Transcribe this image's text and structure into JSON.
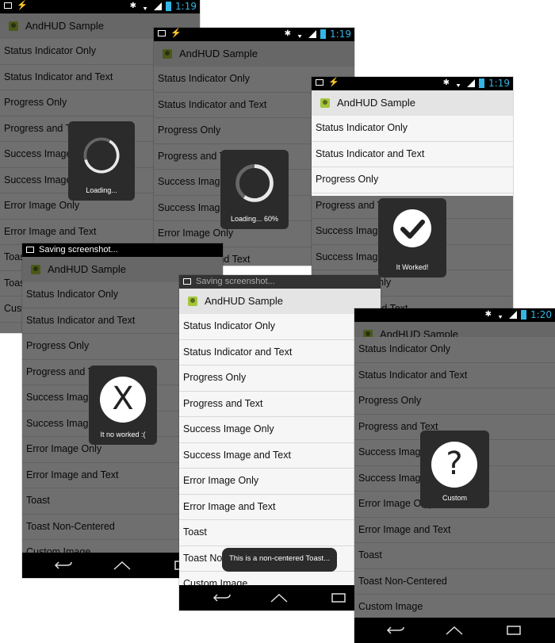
{
  "app": {
    "title": "AndHUD Sample"
  },
  "colors": {
    "accent": "#33b5e5",
    "hud": "#2b2b2b",
    "statusbar": "#000000",
    "list_bg": "#f6f6f6"
  },
  "status": {
    "time_a": "1:19",
    "time_b": "1:20",
    "saving": "Saving screenshot..."
  },
  "menu": [
    "Status Indicator Only",
    "Status Indicator and Text",
    "Progress Only",
    "Progress and Text",
    "Success Image Only",
    "Success Image and Text",
    "Error Image Only",
    "Error Image and Text",
    "Toast",
    "Toast Non-Centered",
    "Custom Image"
  ],
  "hud": {
    "loading": "Loading...",
    "progress": "Loading... 60%",
    "progress_fraction": 0.6,
    "success": "It Worked!",
    "error": "It no worked :(",
    "custom": "Custom",
    "custom_symbol": "?",
    "error_symbol": "X",
    "toast": "This is a non-centered Toast..."
  },
  "icons": [
    "android-icon",
    "image-icon",
    "bolt-icon",
    "bluetooth-icon",
    "wifi-icon",
    "signal-icon",
    "battery-icon",
    "back-icon",
    "home-icon",
    "recents-icon",
    "spinner-icon",
    "check-icon"
  ]
}
